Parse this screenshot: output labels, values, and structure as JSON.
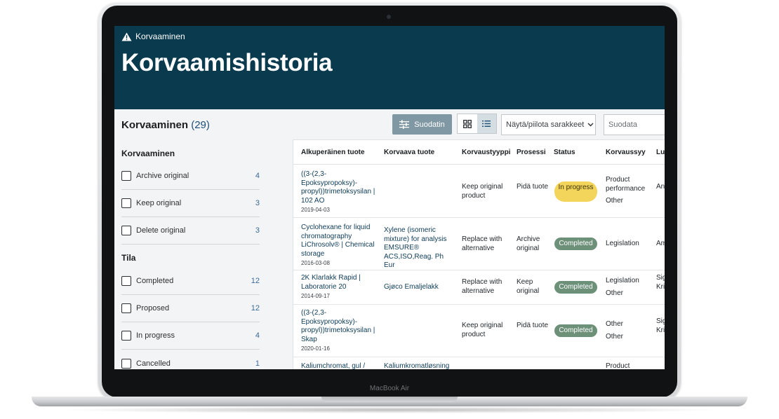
{
  "device": {
    "brand": "MacBook Air"
  },
  "header": {
    "breadcrumb": "Korvaaminen",
    "title": "Korvaamishistoria",
    "bg_color": "#0a3a4e"
  },
  "toolbar": {
    "section_title": "Korvaaminen",
    "count": "(29)",
    "filter_label": "Suodatin",
    "columns_toggle": "Näytä/piilota sarakkeet",
    "search_placeholder": "Suodata"
  },
  "sidebar": {
    "group1_title": "Korvaaminen",
    "group1": [
      {
        "label": "Archive original",
        "count": "4"
      },
      {
        "label": "Keep original",
        "count": "3"
      },
      {
        "label": "Delete original",
        "count": "3"
      }
    ],
    "group2_title": "Tila",
    "group2": [
      {
        "label": "Completed",
        "count": "12"
      },
      {
        "label": "Proposed",
        "count": "12"
      },
      {
        "label": "In progress",
        "count": "4"
      },
      {
        "label": "Cancelled",
        "count": "1"
      }
    ]
  },
  "table": {
    "columns": [
      "Alkuperäinen tuote",
      "Korvaava tuote",
      "Korvaustyyppi",
      "Prosessi",
      "Status",
      "Korvaussyy",
      "Lu"
    ],
    "rows": [
      {
        "original": "((3-(2,3-Epoksypropoksy)-propyl))trimetoksysilan | 102 AO",
        "date": "2019-04-03",
        "replacement": "",
        "type": "Keep original product",
        "process": "Pidä tuote",
        "status": "In progress",
        "reason1": "Product performance",
        "reason2": "Other",
        "extra": "An Km"
      },
      {
        "original": "Cyclohexane for liquid chromatography LiChrosolv® | Chemical storage",
        "date": "2016-03-08",
        "replacement": "Xylene (isomeric mixture) for analysis EMSURE® ACS,ISO,Reag. Ph Eur",
        "type": "Replace with alternative",
        "process": "Archive original",
        "status": "Completed",
        "reason1": "Legislation",
        "reason2": "",
        "extra": "Am"
      },
      {
        "original": "2K Klarlakk Rapid | Laboratorie 20",
        "date": "2014-09-17",
        "replacement": "Gjøco Emaljelakk",
        "type": "Replace with alternative",
        "process": "Keep original",
        "status": "Completed",
        "reason1": "Legislation",
        "reason2": "Other",
        "extra": "Sig Os Kri"
      },
      {
        "original": "((3-(2,3-Epoksypropoksy)-propyl))trimetoksysilan | Skap",
        "date": "2020-01-16",
        "replacement": "",
        "type": "Keep original product",
        "process": "Pidä tuote",
        "status": "Completed",
        "reason1": "Other",
        "reason2": "Other",
        "extra": "Sig Os Kri"
      },
      {
        "original": "Kaliumchromat, gul /",
        "date": "",
        "replacement": "Kaliumkromatløsning",
        "type": "",
        "process": "",
        "status": "",
        "reason1": "Product",
        "reason2": "",
        "extra": ""
      }
    ]
  },
  "colors": {
    "completed": "#6d9079",
    "in_progress": "#f3d55c",
    "filter_button": "#7f98a3",
    "link": "#0d3b57"
  }
}
